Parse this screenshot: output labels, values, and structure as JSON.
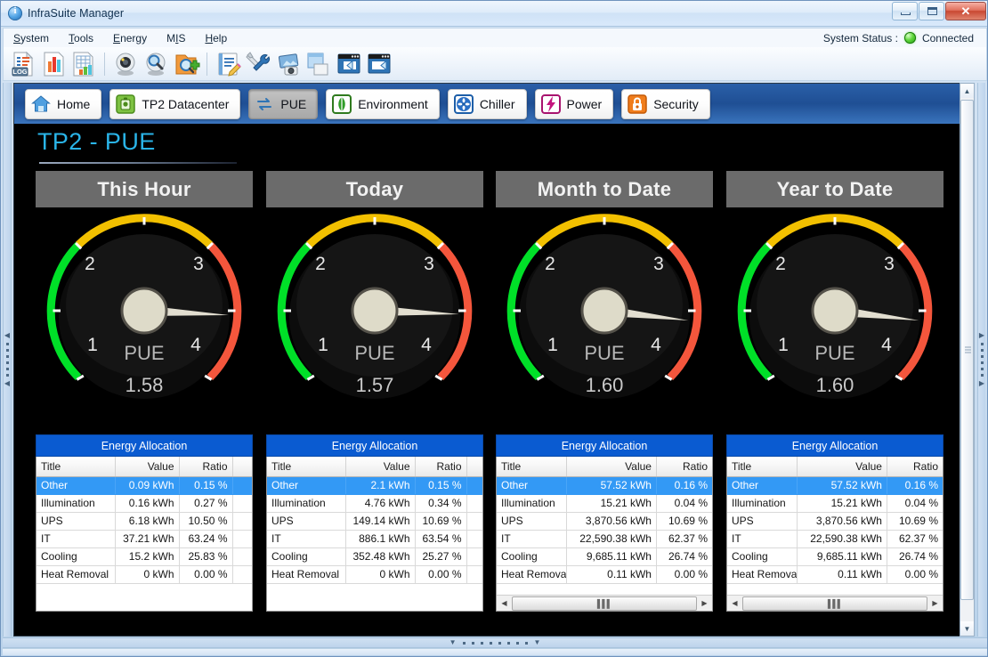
{
  "window": {
    "title": "InfraSuite Manager",
    "icon": "info-icon",
    "minimize": "minimize-icon",
    "maximize": "maximize-icon",
    "close": "✕"
  },
  "menu": {
    "items": [
      {
        "label": "System",
        "accel": "S"
      },
      {
        "label": "Tools",
        "accel": "T"
      },
      {
        "label": "Energy",
        "accel": "E"
      },
      {
        "label": "MIS",
        "accel": "M"
      },
      {
        "label": "Help",
        "accel": "H"
      }
    ],
    "status_label": "System Status :",
    "status_value": "Connected",
    "status_color": "#3fbf20"
  },
  "toolbar": {
    "buttons": [
      {
        "name": "log-report-icon",
        "title": "Log Report"
      },
      {
        "name": "bar-chart-report-icon",
        "title": "Chart Report"
      },
      {
        "name": "table-report-icon",
        "title": "Table Report"
      },
      {
        "name": "device-monitor-icon",
        "title": "Device Monitor"
      },
      {
        "name": "device-search-icon",
        "title": "Device Search"
      },
      {
        "name": "add-device-icon",
        "title": "Add Device"
      },
      {
        "name": "edit-notes-icon",
        "title": "Edit Notes"
      },
      {
        "name": "settings-tools-icon",
        "title": "Settings"
      },
      {
        "name": "snapshot-icon",
        "title": "Snapshot"
      },
      {
        "name": "window-layout-icon",
        "title": "Layout"
      },
      {
        "name": "navigate-back-icon",
        "title": "Back"
      },
      {
        "name": "navigate-forward-icon",
        "title": "Forward"
      }
    ]
  },
  "nav": {
    "tabs": [
      {
        "label": "Home",
        "icon": "home-icon",
        "active": false
      },
      {
        "label": "TP2 Datacenter",
        "icon": "datacenter-icon",
        "active": false
      },
      {
        "label": "PUE",
        "icon": "pue-exchange-icon",
        "active": true
      },
      {
        "label": "Environment",
        "icon": "leaf-icon",
        "active": false
      },
      {
        "label": "Chiller",
        "icon": "chiller-fan-icon",
        "active": false
      },
      {
        "label": "Power",
        "icon": "power-bolt-icon",
        "active": false
      },
      {
        "label": "Security",
        "icon": "lock-icon",
        "active": false
      }
    ]
  },
  "page": {
    "title": "TP2 - PUE",
    "title_color": "#2ab4e8"
  },
  "chart_data": {
    "type": "gauge",
    "title": "TP2 - PUE",
    "unit": "PUE",
    "axis_min": 1,
    "axis_max": 4,
    "tick_labels": [
      "1",
      "2",
      "3",
      "4"
    ],
    "bands": [
      {
        "from": 1,
        "to": 2,
        "color": "#00e028",
        "name": "good"
      },
      {
        "from": 2,
        "to": 3,
        "color": "#f2c000",
        "name": "warning"
      },
      {
        "from": 3,
        "to": 4,
        "color": "#f4563c",
        "name": "critical"
      }
    ],
    "gauges": [
      {
        "period": "This Hour",
        "value": 1.58,
        "value_label": "1.58"
      },
      {
        "period": "Today",
        "value": 1.57,
        "value_label": "1.57"
      },
      {
        "period": "Month to Date",
        "value": 1.6,
        "value_label": "1.60"
      },
      {
        "period": "Year to Date",
        "value": 1.6,
        "value_label": "1.60"
      }
    ]
  },
  "tables": {
    "title": "Energy Allocation",
    "columns": [
      "Title",
      "Value",
      "Ratio"
    ],
    "panels": [
      {
        "period": "This Hour",
        "has_scrollbar": false,
        "rows": [
          {
            "title": "Other",
            "value": "0.09 kWh",
            "ratio": "0.15 %",
            "selected": true
          },
          {
            "title": "Illumination",
            "value": "0.16 kWh",
            "ratio": "0.27 %",
            "selected": false
          },
          {
            "title": "UPS",
            "value": "6.18 kWh",
            "ratio": "10.50 %",
            "selected": false
          },
          {
            "title": "IT",
            "value": "37.21 kWh",
            "ratio": "63.24 %",
            "selected": false
          },
          {
            "title": "Cooling",
            "value": "15.2 kWh",
            "ratio": "25.83 %",
            "selected": false
          },
          {
            "title": "Heat Removal",
            "value": "0 kWh",
            "ratio": "0.00 %",
            "selected": false
          }
        ]
      },
      {
        "period": "Today",
        "has_scrollbar": false,
        "rows": [
          {
            "title": "Other",
            "value": "2.1 kWh",
            "ratio": "0.15 %",
            "selected": true
          },
          {
            "title": "Illumination",
            "value": "4.76 kWh",
            "ratio": "0.34 %",
            "selected": false
          },
          {
            "title": "UPS",
            "value": "149.14 kWh",
            "ratio": "10.69 %",
            "selected": false
          },
          {
            "title": "IT",
            "value": "886.1 kWh",
            "ratio": "63.54 %",
            "selected": false
          },
          {
            "title": "Cooling",
            "value": "352.48 kWh",
            "ratio": "25.27 %",
            "selected": false
          },
          {
            "title": "Heat Removal",
            "value": "0 kWh",
            "ratio": "0.00 %",
            "selected": false
          }
        ]
      },
      {
        "period": "Month to Date",
        "has_scrollbar": true,
        "rows": [
          {
            "title": "Other",
            "value": "57.52 kWh",
            "ratio": "0.16 %",
            "selected": true
          },
          {
            "title": "Illumination",
            "value": "15.21 kWh",
            "ratio": "0.04 %",
            "selected": false
          },
          {
            "title": "UPS",
            "value": "3,870.56 kWh",
            "ratio": "10.69 %",
            "selected": false
          },
          {
            "title": "IT",
            "value": "22,590.38 kWh",
            "ratio": "62.37 %",
            "selected": false
          },
          {
            "title": "Cooling",
            "value": "9,685.11 kWh",
            "ratio": "26.74 %",
            "selected": false
          },
          {
            "title": "Heat Removal",
            "value": "0.11 kWh",
            "ratio": "0.00 %",
            "selected": false
          }
        ]
      },
      {
        "period": "Year to Date",
        "has_scrollbar": true,
        "rows": [
          {
            "title": "Other",
            "value": "57.52 kWh",
            "ratio": "0.16 %",
            "selected": true
          },
          {
            "title": "Illumination",
            "value": "15.21 kWh",
            "ratio": "0.04 %",
            "selected": false
          },
          {
            "title": "UPS",
            "value": "3,870.56 kWh",
            "ratio": "10.69 %",
            "selected": false
          },
          {
            "title": "IT",
            "value": "22,590.38 kWh",
            "ratio": "62.37 %",
            "selected": false
          },
          {
            "title": "Cooling",
            "value": "9,685.11 kWh",
            "ratio": "26.74 %",
            "selected": false
          },
          {
            "title": "Heat Removal",
            "value": "0.11 kWh",
            "ratio": "0.00 %",
            "selected": false
          }
        ]
      }
    ]
  },
  "scrollbars": {
    "vertical_up": "▲",
    "vertical_down": "▼",
    "left_arrow": "◀",
    "right_arrow": "▶",
    "grip": "❙❙❙"
  }
}
